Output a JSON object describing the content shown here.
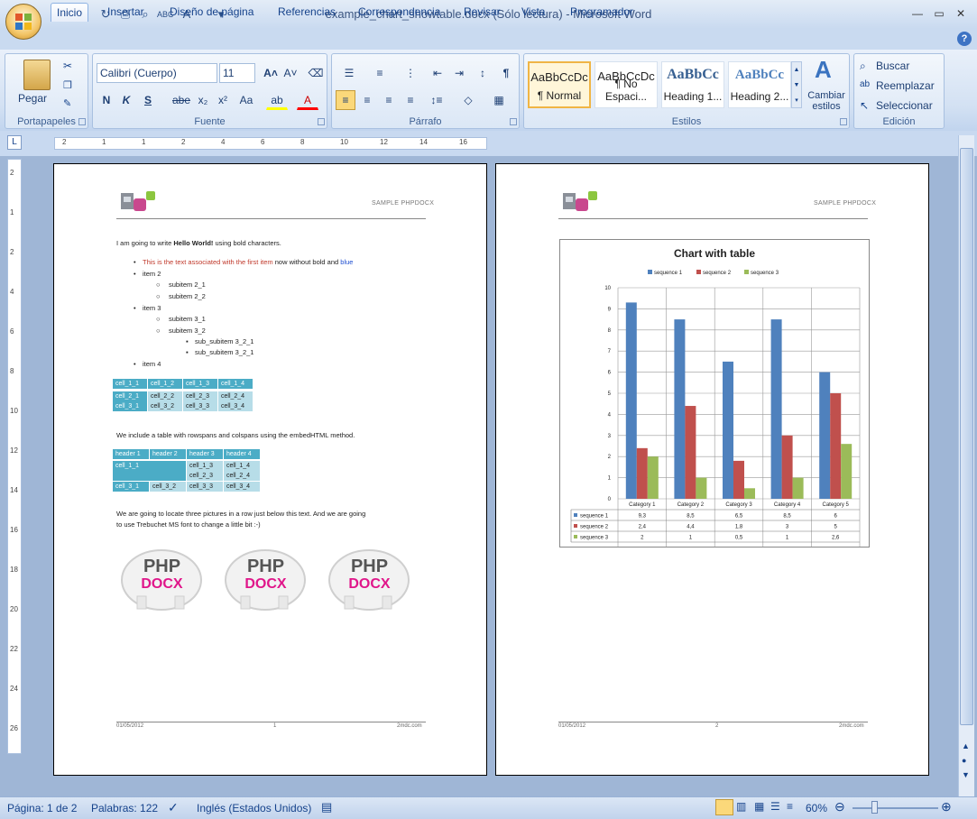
{
  "window": {
    "title": "example_chart_showtable.docx (Sólo lectura) - Microsoft Word"
  },
  "tabs": [
    "Inicio",
    "Insertar",
    "Diseño de página",
    "Referencias",
    "Correspondencia",
    "Revisar",
    "Vista",
    "Programador"
  ],
  "ribbon": {
    "clipboard": {
      "paste": "Pegar",
      "label": "Portapapeles"
    },
    "font": {
      "family": "Calibri (Cuerpo)",
      "size": "11",
      "label": "Fuente",
      "bold": "N",
      "italic": "K",
      "underline": "S",
      "strike": "abe",
      "sub": "x₂",
      "sup": "x²",
      "case": "Aa"
    },
    "paragraph": {
      "label": "Párrafo"
    },
    "styles": {
      "label": "Estilos",
      "items": [
        {
          "preview": "AaBbCcDc",
          "name": "¶ Normal"
        },
        {
          "preview": "AaBbCcDc",
          "name": "¶ No Espaci..."
        },
        {
          "preview": "AaBbCc",
          "name": "Heading 1..."
        },
        {
          "preview": "AaBbCc",
          "name": "Heading 2..."
        }
      ],
      "change": "Cambiar estilos"
    },
    "editing": {
      "label": "Edición",
      "find": "Buscar",
      "replace": "Reemplazar",
      "select": "Seleccionar"
    }
  },
  "ruler": {
    "ticks": [
      "2",
      "1",
      "1",
      "2",
      "4",
      "6",
      "8",
      "10",
      "12",
      "14",
      "16"
    ],
    "vticks": [
      "2",
      "1",
      "2",
      "4",
      "6",
      "8",
      "10",
      "12",
      "14",
      "16",
      "18",
      "20",
      "22",
      "24",
      "26"
    ]
  },
  "page1": {
    "header": "SAMPLE PHPDOCX",
    "intro_pre": "I am going to write ",
    "intro_bold": "Hello World!",
    "intro_post": " using bold characters.",
    "bullet1_red": "This is the text associated with the first item",
    "bullet1_mid": " now without bold and ",
    "bullet1_blue": "blue",
    "items": [
      "item 2",
      "subitem 2_1",
      "subitem 2_2",
      "item 3",
      "subitem 3_1",
      "subitem 3_2",
      "sub_subitem 3_2_1",
      "sub_subitem 3_2_1",
      "item 4"
    ],
    "table1": [
      [
        "cell_1_1",
        "cell_1_2",
        "cell_1_3",
        "cell_1_4"
      ],
      [
        "cell_2_1",
        "cell_2_2",
        "cell_2_3",
        "cell_2_4"
      ],
      [
        "cell_3_1",
        "cell_3_2",
        "cell_3_3",
        "cell_3_4"
      ]
    ],
    "embed_text": "We include a table with rowspans and colspans using the embedHTML method.",
    "table2_headers": [
      "header 1",
      "header 2",
      "header 3",
      "header 4"
    ],
    "table2_cells": [
      "cell_1_1",
      "cell_1_3",
      "cell_1_4",
      "cell_2_3",
      "cell_2_4",
      "cell_3_1",
      "cell_3_2",
      "cell_3_3",
      "cell_3_4"
    ],
    "pictures_text_1": "We are going to locate three pictures in a row just below this text. And we are going",
    "pictures_text_2": "to use Trebuchet MS font to change a little bit :-)",
    "elephant_top": "PHP",
    "elephant_bottom": "DOCX",
    "footer_date": "01/05/2012",
    "footer_page": "1",
    "footer_site": "2mdc.com"
  },
  "page2": {
    "header": "SAMPLE PHPDOCX",
    "footer_date": "01/05/2012",
    "footer_page": "2",
    "footer_site": "2mdc.com"
  },
  "chart_data": {
    "type": "bar",
    "title": "Chart with table",
    "categories": [
      "Category 1",
      "Category 2",
      "Category 3",
      "Category 4",
      "Category 5"
    ],
    "series": [
      {
        "name": "sequence 1",
        "color": "#4f81bd",
        "values": [
          9.3,
          8.5,
          6.5,
          8.5,
          6
        ]
      },
      {
        "name": "sequence 2",
        "color": "#c0504d",
        "values": [
          2.4,
          4.4,
          1.8,
          3,
          5
        ]
      },
      {
        "name": "sequence 3",
        "color": "#9bbb59",
        "values": [
          2,
          1,
          0.5,
          1,
          2.6
        ]
      }
    ],
    "table_values": [
      [
        "9,3",
        "8,5",
        "6,5",
        "8,5",
        "6"
      ],
      [
        "2,4",
        "4,4",
        "1,8",
        "3",
        "5"
      ],
      [
        "2",
        "1",
        "0,5",
        "1",
        "2,6"
      ]
    ],
    "ylim": [
      0,
      10
    ],
    "yticks": [
      "0",
      "1",
      "2",
      "3",
      "4",
      "5",
      "6",
      "7",
      "8",
      "9",
      "10"
    ],
    "legend_position": "top",
    "grid": true
  },
  "status": {
    "page": "Página: 1 de 2",
    "words": "Palabras: 122",
    "language": "Inglés (Estados Unidos)",
    "zoom": "60%"
  }
}
